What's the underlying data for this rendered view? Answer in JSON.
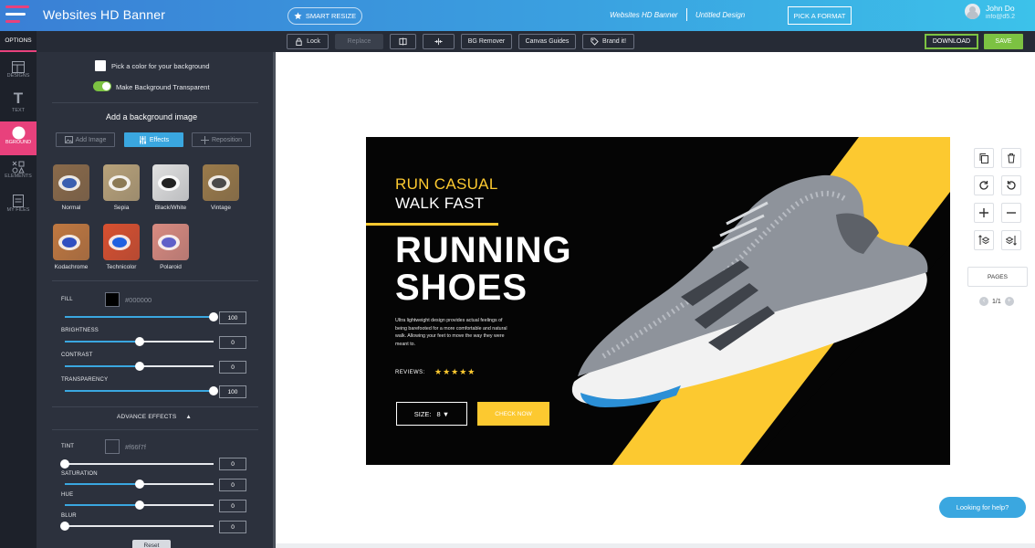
{
  "app": {
    "title": "Websites HD Banner"
  },
  "header": {
    "smart_resize": "SMART RESIZE",
    "breadcrumb_format": "Websites HD Banner",
    "breadcrumb_design": "Untitled Design",
    "pick_format": "PICK A FORMAT",
    "user_name": "John Do",
    "user_email": "info@d5.2"
  },
  "toolbar": {
    "options_tab": "OPTIONS",
    "lock": "Lock",
    "replace": "Replace",
    "bg_remover": "BG Remover",
    "canvas_guides": "Canvas Guides",
    "brand_it": "Brand it!",
    "download": "DOWNLOAD",
    "save": "SAVE"
  },
  "rail": {
    "items": [
      {
        "label": "DESIGNS",
        "icon": "layout-icon"
      },
      {
        "label": "TEXT",
        "icon": "text-icon"
      },
      {
        "label": "BGROUND",
        "icon": "circle-icon"
      },
      {
        "label": "ELEMENTS",
        "icon": "shapes-icon"
      },
      {
        "label": "MY FILES",
        "icon": "files-icon"
      }
    ]
  },
  "panel": {
    "pick_color": "Pick a color for your background",
    "transparent": "Make Background Transparent",
    "add_bg_image": "Add a background image",
    "add_image": "Add Image",
    "effects": "Effects",
    "reposition": "Reposition",
    "filters": [
      {
        "label": "Normal",
        "bg": "#8a6a4a",
        "cup": "#3a5fb0"
      },
      {
        "label": "Sepia",
        "bg": "#b8a27a",
        "cup": "#8c7a55"
      },
      {
        "label": "Black/White",
        "bg": "#e0e0e0",
        "cup": "#222222"
      },
      {
        "label": "Vintage",
        "bg": "#9a7a4a",
        "cup": "#4a4a4a"
      },
      {
        "label": "Kodachrome",
        "bg": "#c07840",
        "cup": "#3050c0"
      },
      {
        "label": "Technicolor",
        "bg": "#d85030",
        "cup": "#2060e0"
      },
      {
        "label": "Polaroid",
        "bg": "#d88a80",
        "cup": "#6060c8"
      }
    ],
    "fill_label": "FILL",
    "fill_hex": "#000000",
    "fill_color": "#000000",
    "fill_value": "100",
    "brightness_label": "BRIGHTNESS",
    "brightness_value": "0",
    "contrast_label": "CONTRAST",
    "contrast_value": "0",
    "transparency_label": "TRANSPARENCY",
    "transparency_value": "100",
    "advance_effects": "ADVANCE EFFECTS",
    "tint_label": "TINT",
    "tint_hex": "#f66f7f",
    "saturation_label": "SATURATION",
    "saturation_value": "0",
    "hue_label": "HUE",
    "hue_value": "0",
    "blur_label": "BLUR",
    "blur_value": "0",
    "tint_value": "0",
    "reset": "Reset",
    "slider_levels": {
      "fill": 1.0,
      "brightness": 0.5,
      "contrast": 0.5,
      "transparency": 1.0,
      "tint": 0.0,
      "saturation": 0.5,
      "hue": 0.5,
      "blur": 0.0
    }
  },
  "banner": {
    "line1": "RUN CASUAL",
    "line2": "WALK FAST",
    "big1": "RUNNING",
    "big2": "SHOES",
    "description": "Ultra lightweight design provides actual feelings of being barefooted for a more comfortable and natural walk. Allowing your feet to move the way they were meant to.",
    "reviews_label": "REVIEWS:",
    "stars": "★★★★★",
    "size_label": "SIZE:",
    "size_value": "8 ▼",
    "cta": "CHECK NOW"
  },
  "right_panel": {
    "pages_label": "PAGES",
    "page_indicator": "1/1"
  },
  "help": "Looking for help?",
  "colors": {
    "accent": "#3aa7e0",
    "brand_pink": "#e8417c",
    "save_green": "#7cc242",
    "banner_yellow": "#fcc930"
  }
}
